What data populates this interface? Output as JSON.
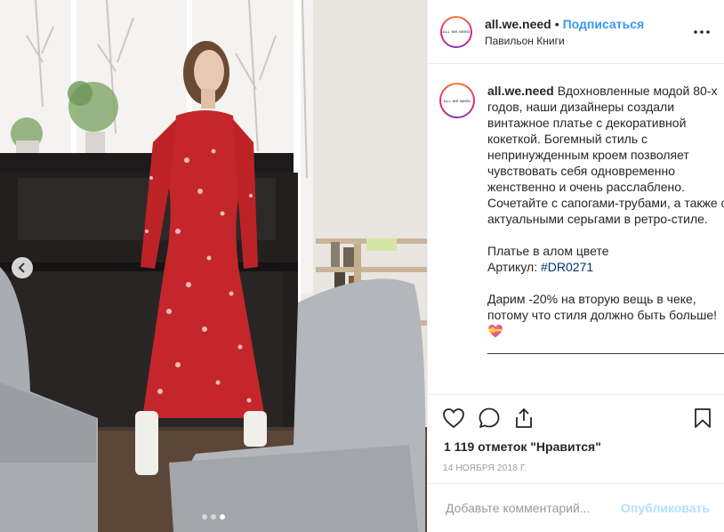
{
  "post": {
    "image_alt": "Woman in red floral dress standing by a piano",
    "carousel": {
      "count": 3,
      "active_index": 2
    }
  },
  "header": {
    "avatar_text": "ALL WE NEED",
    "username": "all.we.need",
    "bullet": "•",
    "follow_label": "Подписаться",
    "location": "Павильон Книги"
  },
  "caption": {
    "username": "all.we.need",
    "text_1": "Вдохновленные модой 80-х годов, наши дизайнеры создали винтажное платье с декоративной кокеткой. Богемный стиль с непринужденным кроем позволяет чувствовать себя одновременно женственно и очень расслаблено. Сочетайте с сапогами-трубами, а также с актуальными серьгами в ретро-стиле.",
    "text_2": "Платье в алом цвете",
    "sku_label": "Артикул:",
    "hashtag": "#DR0271",
    "text_3": "Дарим -20% на вторую вещь в чеке, потому что стиля должно быть больше!💝",
    "divider": "___________________________________"
  },
  "likes": "1 119 отметок \"Нравится\"",
  "date": "14 ноября 2018 г.",
  "comment": {
    "placeholder": "Добавьте комментарий...",
    "post_label": "Опубликовать"
  },
  "icons": {
    "prev": "chevron-left-icon",
    "more": "more-horizontal-icon",
    "like": "heart-icon",
    "comment": "comment-icon",
    "share": "share-icon",
    "save": "bookmark-icon"
  }
}
